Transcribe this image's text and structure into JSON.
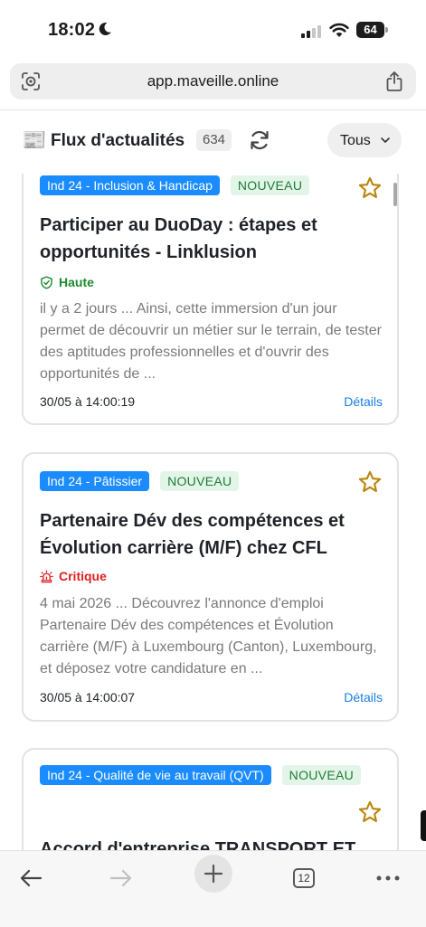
{
  "status": {
    "time": "18:02",
    "battery": "64"
  },
  "browser": {
    "url": "app.maveille.online",
    "tab_count": "12"
  },
  "header": {
    "title": "Flux d'actualités",
    "count": "634",
    "filter": "Tous"
  },
  "icons": {
    "header": "newspaper-icon",
    "refresh": "refresh-icon",
    "star": "star-outline-icon",
    "priority_high": "shield-check-icon",
    "priority_critical": "siren-icon"
  },
  "colors": {
    "accent": "#1a8cff",
    "new_badge_bg": "#e3f5e8",
    "new_badge_text": "#1e7b34",
    "star": "#b8860b",
    "high": "#1e8a2e",
    "critical": "#e02020",
    "link": "#1a7fe0"
  },
  "cards": [
    {
      "category": "Ind 24 - Inclusion & Handicap",
      "badge": "NOUVEAU",
      "title": "Participer au DuoDay : étapes et opportunités - Linklusion",
      "priority": "Haute",
      "snippet": "il y a 2 jours ... Ainsi, cette immersion d'un jour permet de découvrir un métier sur le terrain, de tester des aptitudes professionnelles et d'ouvrir des opportunités de ...",
      "date": "30/05 à 14:00:19",
      "details": "Détails"
    },
    {
      "category": "Ind 24 - Pâtissier",
      "badge": "NOUVEAU",
      "title": "Partenaire Dév des compétences et Évolution carrière (M/F) chez CFL",
      "priority": "Critique",
      "snippet": "4 mai 2026 ... Découvrez l'annonce d'emploi Partenaire Dév des compétences et Évolution carrière (M/F) à Luxembourg (Canton), Luxembourg, et déposez votre candidature en ...",
      "date": "30/05 à 14:00:07",
      "details": "Détails"
    },
    {
      "category": "Ind 24 - Qualité de vie au travail (QVT)",
      "badge": "NOUVEAU",
      "title": "Accord d'entreprise TRANSPORT ET"
    }
  ]
}
